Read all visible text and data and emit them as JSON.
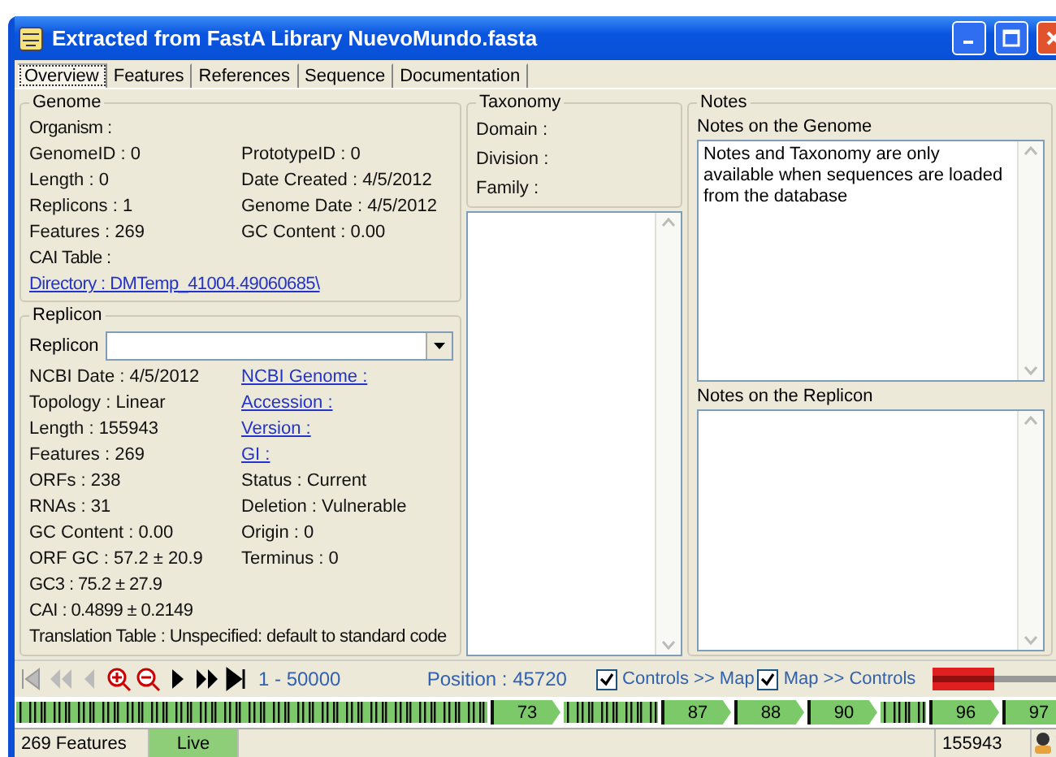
{
  "window": {
    "title": "Extracted from FastA Library NuevoMundo.fasta"
  },
  "tabs": [
    {
      "label": "Overview",
      "selected": true
    },
    {
      "label": "Features",
      "selected": false
    },
    {
      "label": "References",
      "selected": false
    },
    {
      "label": "Sequence",
      "selected": false
    },
    {
      "label": "Documentation",
      "selected": false
    }
  ],
  "genome": {
    "title": "Genome",
    "rows": [
      [
        "Organism :"
      ],
      [
        "GenomeID : 0",
        "PrototypeID : 0"
      ],
      [
        "Length : 0",
        "Date Created : 4/5/2012"
      ],
      [
        "Replicons : 1",
        "Genome Date : 4/5/2012"
      ],
      [
        "Features : 269",
        "GC Content : 0.00"
      ],
      [
        "CAI Table :"
      ]
    ],
    "directory": "Directory : DMTemp_41004.49060685\\"
  },
  "replicon": {
    "title": "Replicon",
    "combo_label": "Replicon",
    "rows": [
      [
        {
          "text": "NCBI Date : 4/5/2012",
          "link": false
        },
        {
          "text": "NCBI Genome :",
          "link": true
        }
      ],
      [
        {
          "text": "Topology : Linear",
          "link": false
        },
        {
          "text": "Accession :",
          "link": true
        }
      ],
      [
        {
          "text": "Length : 155943",
          "link": false
        },
        {
          "text": "Version :",
          "link": true
        }
      ],
      [
        {
          "text": "Features : 269",
          "link": false
        },
        {
          "text": "GI :",
          "link": true
        }
      ],
      [
        {
          "text": "ORFs : 238",
          "link": false
        },
        {
          "text": "Status : Current",
          "link": false
        }
      ],
      [
        {
          "text": "RNAs : 31",
          "link": false
        },
        {
          "text": "Deletion : Vulnerable",
          "link": false
        }
      ],
      [
        {
          "text": "GC Content : 0.00",
          "link": false
        },
        {
          "text": "Origin : 0",
          "link": false
        }
      ],
      [
        {
          "text": "ORF GC : 57.2 ± 20.9",
          "link": false
        },
        {
          "text": "Terminus : 0",
          "link": false
        }
      ],
      [
        {
          "text": "GC3 : 75.2 ± 27.9",
          "link": false
        }
      ],
      [
        {
          "text": "CAI : 0.4899 ± 0.2149",
          "link": false
        }
      ],
      [
        {
          "text": "Translation Table : Unspecified: default to standard code",
          "link": false
        }
      ]
    ]
  },
  "taxonomy": {
    "title": "Taxonomy",
    "fields": [
      "Domain :",
      "Division :",
      "Family :"
    ]
  },
  "notes": {
    "title": "Notes",
    "genome_label": "Notes on the Genome",
    "genome_text": "Notes and Taxonomy are only available when sequences are loaded from the database",
    "replicon_label": "Notes on the Replicon"
  },
  "toolbar": {
    "range": "1 - 50000",
    "position": "Position : 45720",
    "checks": [
      {
        "label": "Controls >> Map",
        "checked": true
      },
      {
        "label": "Map >> Controls",
        "checked": true
      }
    ]
  },
  "map": [
    {
      "kind": "cluster"
    },
    {
      "kind": "gene",
      "label": "73"
    },
    {
      "kind": "cluster"
    },
    {
      "kind": "gene",
      "label": "87"
    },
    {
      "kind": "gene",
      "label": "88"
    },
    {
      "kind": "gene",
      "label": "90"
    },
    {
      "kind": "cluster"
    },
    {
      "kind": "gene",
      "label": "96"
    },
    {
      "kind": "gene",
      "label": "97"
    }
  ],
  "status_bar": {
    "features": "269 Features",
    "mode": "Live",
    "length": "155943"
  }
}
